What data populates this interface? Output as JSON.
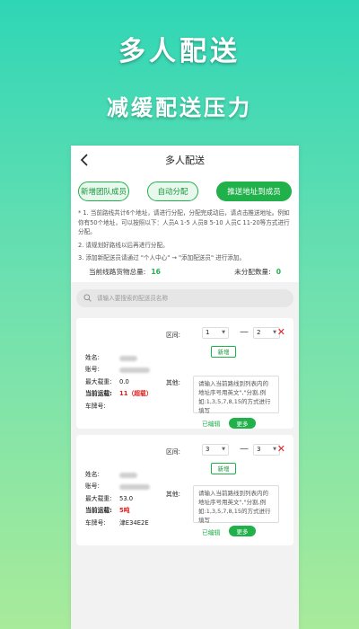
{
  "promo": {
    "title": "多人配送",
    "subtitle": "减缓配送压力"
  },
  "header": {
    "title": "多人配送"
  },
  "actions": {
    "add_member": "新增团队成员",
    "auto_assign": "自动分配",
    "push_address": "推送地址到成员"
  },
  "notes": [
    "* 1. 当前路线共计6个地址，请进行分配，分配完成动后，请点击推送地址。例如你有50个地址，可以按照以下：人员A 1-5 人员B 5-10 人员C 11-20等方式进行分配。",
    "2. 请规划好路线以后再进行分配。",
    "3. 添加新配送员请通过 \"个人中心\" → \"添加配送员\" 进行添加。"
  ],
  "stats": {
    "total_label": "当前线路货物总量:",
    "total_value": "16",
    "unassigned_label": "未分配数量:",
    "unassigned_value": "0"
  },
  "search": {
    "placeholder": "请输入要搜索的配送员名称"
  },
  "labels": {
    "name": "姓名:",
    "account": "账号:",
    "max_load": "最大载重:",
    "current_load": "当前运载:",
    "plate": "车牌号:",
    "range": "区间:",
    "add": "新增",
    "other": "其他:",
    "edited": "已编辑",
    "more": "更多",
    "dash": "—",
    "remark_placeholder": "请输入当前路线到列表内的地址序号用英文\",\"分割,例如:1,3,5,7,8,15的方式进行填写"
  },
  "members": [
    {
      "max_load": "0.0",
      "current_load": "11（超载）",
      "plate": "",
      "range_start": "1",
      "range_end": "2"
    },
    {
      "max_load": "53.0",
      "current_load": "5吨",
      "plate": "津E34E2E",
      "range_start": "3",
      "range_end": "3"
    }
  ],
  "colors": {
    "accent": "#21b14b",
    "warning": "#e02020",
    "background_top": "#2fd6b6",
    "background_bottom": "#a8eb9a"
  }
}
